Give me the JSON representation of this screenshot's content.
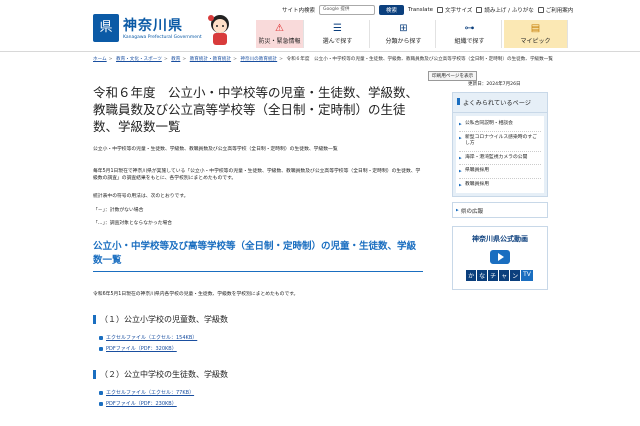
{
  "header": {
    "logo_mark": "県",
    "logo_title": "神奈川県",
    "logo_sub": "Kanagawa Prefectural Government",
    "site_search_label": "サイト内検索",
    "search_placeholder": "Google 提供",
    "search_button": "検索",
    "util": {
      "translate": "Translate",
      "text_size": "文字サイズ",
      "read_aloud": "読み上げ / ふりがな",
      "usage": "ご利用案内"
    },
    "nav": [
      {
        "label": "防災・緊急情報",
        "icon": "warning-icon"
      },
      {
        "label": "選んで探す",
        "icon": "select-icon"
      },
      {
        "label": "分類から探す",
        "icon": "category-icon"
      },
      {
        "label": "組織で探す",
        "icon": "organization-icon"
      },
      {
        "label": "マイピック",
        "icon": "mypick-icon"
      }
    ]
  },
  "breadcrumb": {
    "items": [
      "ホーム",
      "教育・文化・スポーツ",
      "教育",
      "教育統計・教育統計",
      "神奈川の教育統計"
    ],
    "current": "令和６年度　公立小・中学校等の児童・生徒数、学級数、教職員数及び公立高等学校等（全日制・定時制）の生徒数、学級数一覧"
  },
  "meta": {
    "print_label": "印刷用ページを表示",
    "updated": "更新日：2024年7月26日"
  },
  "main": {
    "title": "令和６年度　公立小・中学校等の児童・生徒数、学級数、教職員数及び公立高等学校等（全日制・定時制）の生徒数、学級数一覧",
    "lead": "公立小・中学校等の児童・生徒数、学級数、教職員数及び公立高等学校（全日制・定時制）の生徒数、学級数一覧",
    "body1": "毎年5月1日現在で神奈川県が実施している「公立小・中学校等の児童・生徒数、学級数、教職員数及び公立高等学校等（全日制・定時制）の生徒数、学級数の調査」の調査結果をもとに、各学校別にまとめたものです。",
    "body2": "統計表中の符号の用法は、次のとおりです。",
    "body3": "「－」：計数がない場合",
    "body4": "「…」：調査対象とならなかった場合",
    "h2": "公立小・中学校等及び高等学校等（全日制・定時制）の児童・生徒数、学級数一覧",
    "h2_note": "令和6年5月1日現在の神奈川県内各学校の児童・生徒数、学級数を学校別にまとめたものです。",
    "sections": [
      {
        "heading": "（１）公立小学校の児童数、学級数",
        "links": [
          "エクセルファイル（エクセル：154KB）",
          "PDFファイル（PDF：320KB）"
        ]
      },
      {
        "heading": "（２）公立中学校の生徒数、学級数",
        "links": [
          "エクセルファイル（エクセル：77KB）",
          "PDFファイル（PDF：230KB）"
        ]
      }
    ]
  },
  "sidebar": {
    "popular_heading": "よくみられているページ",
    "popular": [
      "公私合同説明・相談会",
      "新型コロナウイルス感染時のすごし方",
      "海岸・港湾監視カメラの公開",
      "県職員採用",
      "教職員採用"
    ],
    "pref_box": "県の広報",
    "video_title": "神奈川県公式動画",
    "kana_chars": [
      "か",
      "な",
      "チ",
      "ャ",
      "ン"
    ],
    "kana_tv": "TV"
  }
}
